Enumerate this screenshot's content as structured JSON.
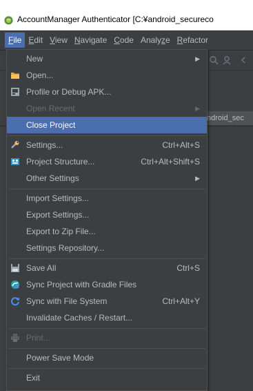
{
  "window": {
    "title": "AccountManager Authenticator [C:¥android_secureco"
  },
  "menubar": {
    "items": [
      {
        "label": "File",
        "mn": "F",
        "rest": "ile",
        "active": true
      },
      {
        "label": "Edit",
        "mn": "E",
        "rest": "dit"
      },
      {
        "label": "View",
        "mn": "V",
        "rest": "iew"
      },
      {
        "label": "Navigate",
        "mn": "N",
        "rest": "avigate"
      },
      {
        "label": "Code",
        "mn": "C",
        "rest": "ode"
      },
      {
        "label": "Analyze",
        "pre": "Analy",
        "mn": "z",
        "rest": "e"
      },
      {
        "label": "Refactor",
        "mn": "R",
        "rest": "efactor"
      }
    ]
  },
  "background": {
    "editor_tab": "ndroid_sec"
  },
  "file_menu": {
    "new": "New",
    "open": "Open...",
    "profile_debug_apk": "Profile or Debug APK...",
    "open_recent": "Open Recent",
    "close_project": "Close Project",
    "settings": "Settings...",
    "settings_shortcut": "Ctrl+Alt+S",
    "project_structure": "Project Structure...",
    "project_structure_shortcut": "Ctrl+Alt+Shift+S",
    "other_settings": "Other Settings",
    "import_settings": "Import Settings...",
    "export_settings": "Export Settings...",
    "export_zip": "Export to Zip File...",
    "settings_repository": "Settings Repository...",
    "save_all": "Save All",
    "save_all_shortcut": "Ctrl+S",
    "sync_gradle": "Sync Project with Gradle Files",
    "sync_file_system": "Sync with File System",
    "sync_file_system_shortcut": "Ctrl+Alt+Y",
    "invalidate_caches": "Invalidate Caches / Restart...",
    "print": "Print...",
    "power_save_mode": "Power Save Mode",
    "exit": "Exit"
  },
  "colors": {
    "menu_bg": "#3c3f41",
    "selection": "#4b6eaf",
    "text": "#bbbbbb",
    "disabled_text": "#6c6c6c"
  },
  "icons": {
    "app": "android-head-icon",
    "open": "folder-icon",
    "profile": "apk-profile-icon",
    "settings": "wrench-icon",
    "project_structure": "project-structure-icon",
    "save_all": "floppy-disk-icon",
    "sync_gradle": "gradle-sync-icon",
    "sync_fs": "refresh-icon",
    "print": "printer-icon"
  }
}
